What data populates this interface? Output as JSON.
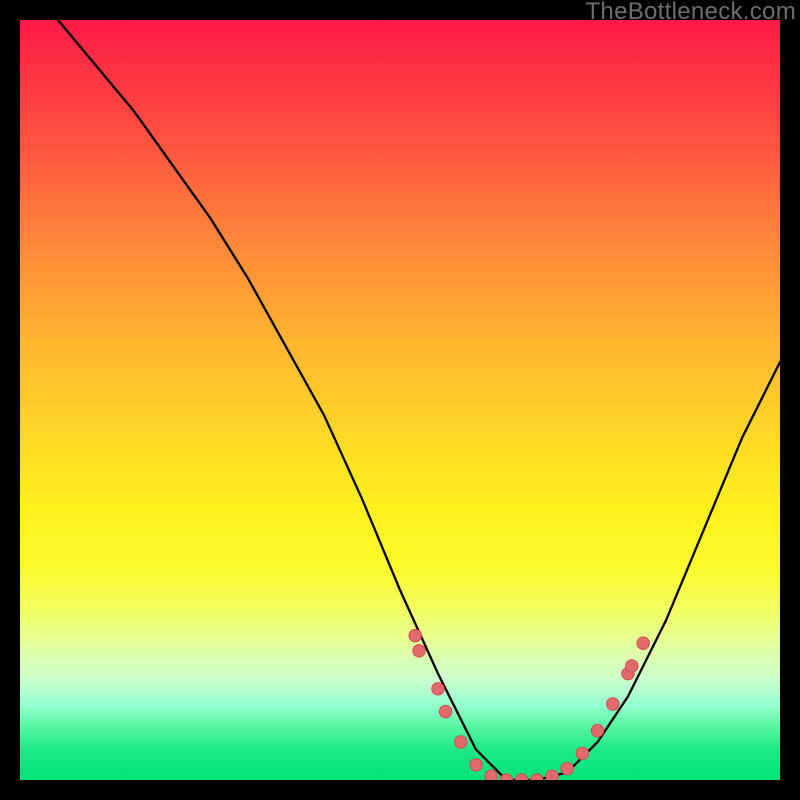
{
  "watermark": "TheBottleneck.com",
  "colors": {
    "background": "#000000",
    "curve": "#000000",
    "marker_fill": "#e26a6c",
    "marker_stroke": "#d14b4e"
  },
  "chart_data": {
    "type": "line",
    "title": "",
    "xlabel": "",
    "ylabel": "",
    "xlim": [
      0,
      100
    ],
    "ylim": [
      0,
      100
    ],
    "curve": {
      "x": [
        0,
        5,
        10,
        15,
        20,
        25,
        30,
        35,
        40,
        45,
        50,
        55,
        58,
        60,
        64,
        68,
        72,
        76,
        80,
        85,
        90,
        95,
        100
      ],
      "y": [
        104,
        100,
        94,
        88,
        81,
        74,
        66,
        57,
        48,
        37,
        25,
        14,
        8,
        4,
        0,
        0,
        1,
        5,
        11,
        21,
        33,
        45,
        55
      ]
    },
    "markers": [
      {
        "x": 52,
        "y": 19
      },
      {
        "x": 52.5,
        "y": 17
      },
      {
        "x": 55,
        "y": 12
      },
      {
        "x": 56,
        "y": 9
      },
      {
        "x": 58,
        "y": 5
      },
      {
        "x": 60,
        "y": 2
      },
      {
        "x": 62,
        "y": 0.5
      },
      {
        "x": 64,
        "y": 0
      },
      {
        "x": 66,
        "y": 0
      },
      {
        "x": 68,
        "y": 0
      },
      {
        "x": 70,
        "y": 0.5
      },
      {
        "x": 72,
        "y": 1.5
      },
      {
        "x": 74,
        "y": 3.5
      },
      {
        "x": 76,
        "y": 6.5
      },
      {
        "x": 78,
        "y": 10
      },
      {
        "x": 80,
        "y": 14
      },
      {
        "x": 80.5,
        "y": 15
      },
      {
        "x": 82,
        "y": 18
      }
    ]
  }
}
